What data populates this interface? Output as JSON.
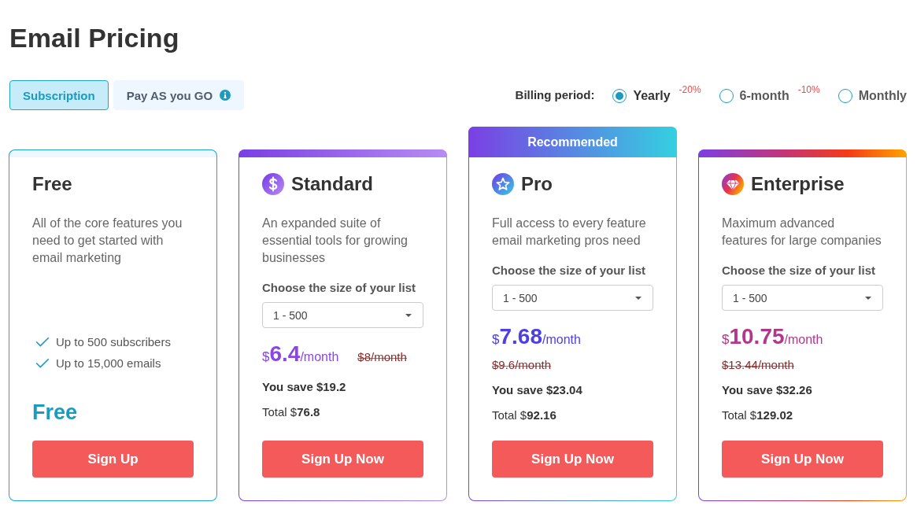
{
  "page_title": "Email Pricing",
  "tabs": [
    {
      "label": "Subscription",
      "selected": true,
      "info": false
    },
    {
      "label": "Pay AS you GO",
      "selected": false,
      "info": true
    }
  ],
  "billing": {
    "label": "Billing period:",
    "options": [
      {
        "label": "Yearly",
        "discount": "-20%",
        "selected": true
      },
      {
        "label": "6-month",
        "discount": "-10%",
        "selected": false
      },
      {
        "label": "Monthly",
        "selected": false
      }
    ]
  },
  "plans": [
    {
      "kind": "free",
      "name": "Free",
      "description": "All of the core features you need to get started with email marketing",
      "features": [
        "Up to 500 subscribers",
        "Up to 15,000 emails"
      ],
      "color": "#1a9bbf",
      "price": "Free",
      "button": "Sign Up"
    },
    {
      "kind": "paid",
      "name": "Standard",
      "description": "An expanded suite of essential tools for growing businesses",
      "list_size": {
        "label": "Choose the size of your list",
        "value": "1 - 500"
      },
      "color": "#8b45e6",
      "currency": "$",
      "amount": "6.4",
      "period": "/month",
      "old_price": "$8/month",
      "savings": "You save $19.2",
      "total": "Total $**76.8**",
      "button": "Sign Up Now"
    },
    {
      "kind": "paid",
      "badge": "Recommended",
      "name": "Pro",
      "description": "Full access to every feature email marketing pros need",
      "list_size": {
        "label": "Choose the size of your list",
        "value": "1 - 500"
      },
      "color": "#4c40e2",
      "currency": "$",
      "amount": "7.68",
      "period": "/month",
      "old_price": "$9.6/month",
      "savings": "You save $23.04",
      "total": "Total $**92.16**",
      "button": "Sign Up Now"
    },
    {
      "kind": "paid",
      "name": "Enterprise",
      "description": "Maximum advanced features for large companies",
      "list_size": {
        "label": "Choose the size of your list",
        "value": "1 - 500"
      },
      "color": "#b2378a",
      "currency": "$",
      "amount": "10.75",
      "period": "/month",
      "old_price": "$13.44/month",
      "savings": "You save $32.26",
      "total": "Total $**129.02**",
      "button": "Sign Up Now"
    }
  ]
}
